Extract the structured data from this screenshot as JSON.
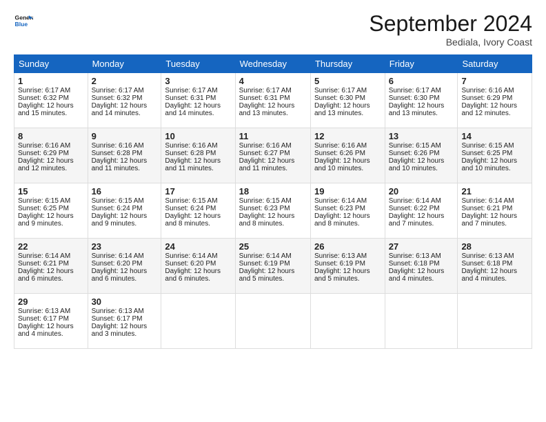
{
  "logo": {
    "line1": "General",
    "line2": "Blue"
  },
  "title": "September 2024",
  "subtitle": "Bediala, Ivory Coast",
  "days_of_week": [
    "Sunday",
    "Monday",
    "Tuesday",
    "Wednesday",
    "Thursday",
    "Friday",
    "Saturday"
  ],
  "weeks": [
    [
      {
        "day": "1",
        "rise": "6:17 AM",
        "set": "6:32 PM",
        "daylight": "12 hours and 15 minutes."
      },
      {
        "day": "2",
        "rise": "6:17 AM",
        "set": "6:32 PM",
        "daylight": "12 hours and 14 minutes."
      },
      {
        "day": "3",
        "rise": "6:17 AM",
        "set": "6:31 PM",
        "daylight": "12 hours and 14 minutes."
      },
      {
        "day": "4",
        "rise": "6:17 AM",
        "set": "6:31 PM",
        "daylight": "12 hours and 13 minutes."
      },
      {
        "day": "5",
        "rise": "6:17 AM",
        "set": "6:30 PM",
        "daylight": "12 hours and 13 minutes."
      },
      {
        "day": "6",
        "rise": "6:17 AM",
        "set": "6:30 PM",
        "daylight": "12 hours and 13 minutes."
      },
      {
        "day": "7",
        "rise": "6:16 AM",
        "set": "6:29 PM",
        "daylight": "12 hours and 12 minutes."
      }
    ],
    [
      {
        "day": "8",
        "rise": "6:16 AM",
        "set": "6:29 PM",
        "daylight": "12 hours and 12 minutes."
      },
      {
        "day": "9",
        "rise": "6:16 AM",
        "set": "6:28 PM",
        "daylight": "12 hours and 11 minutes."
      },
      {
        "day": "10",
        "rise": "6:16 AM",
        "set": "6:28 PM",
        "daylight": "12 hours and 11 minutes."
      },
      {
        "day": "11",
        "rise": "6:16 AM",
        "set": "6:27 PM",
        "daylight": "12 hours and 11 minutes."
      },
      {
        "day": "12",
        "rise": "6:16 AM",
        "set": "6:26 PM",
        "daylight": "12 hours and 10 minutes."
      },
      {
        "day": "13",
        "rise": "6:15 AM",
        "set": "6:26 PM",
        "daylight": "12 hours and 10 minutes."
      },
      {
        "day": "14",
        "rise": "6:15 AM",
        "set": "6:25 PM",
        "daylight": "12 hours and 10 minutes."
      }
    ],
    [
      {
        "day": "15",
        "rise": "6:15 AM",
        "set": "6:25 PM",
        "daylight": "12 hours and 9 minutes."
      },
      {
        "day": "16",
        "rise": "6:15 AM",
        "set": "6:24 PM",
        "daylight": "12 hours and 9 minutes."
      },
      {
        "day": "17",
        "rise": "6:15 AM",
        "set": "6:24 PM",
        "daylight": "12 hours and 8 minutes."
      },
      {
        "day": "18",
        "rise": "6:15 AM",
        "set": "6:23 PM",
        "daylight": "12 hours and 8 minutes."
      },
      {
        "day": "19",
        "rise": "6:14 AM",
        "set": "6:23 PM",
        "daylight": "12 hours and 8 minutes."
      },
      {
        "day": "20",
        "rise": "6:14 AM",
        "set": "6:22 PM",
        "daylight": "12 hours and 7 minutes."
      },
      {
        "day": "21",
        "rise": "6:14 AM",
        "set": "6:21 PM",
        "daylight": "12 hours and 7 minutes."
      }
    ],
    [
      {
        "day": "22",
        "rise": "6:14 AM",
        "set": "6:21 PM",
        "daylight": "12 hours and 6 minutes."
      },
      {
        "day": "23",
        "rise": "6:14 AM",
        "set": "6:20 PM",
        "daylight": "12 hours and 6 minutes."
      },
      {
        "day": "24",
        "rise": "6:14 AM",
        "set": "6:20 PM",
        "daylight": "12 hours and 6 minutes."
      },
      {
        "day": "25",
        "rise": "6:14 AM",
        "set": "6:19 PM",
        "daylight": "12 hours and 5 minutes."
      },
      {
        "day": "26",
        "rise": "6:13 AM",
        "set": "6:19 PM",
        "daylight": "12 hours and 5 minutes."
      },
      {
        "day": "27",
        "rise": "6:13 AM",
        "set": "6:18 PM",
        "daylight": "12 hours and 4 minutes."
      },
      {
        "day": "28",
        "rise": "6:13 AM",
        "set": "6:18 PM",
        "daylight": "12 hours and 4 minutes."
      }
    ],
    [
      {
        "day": "29",
        "rise": "6:13 AM",
        "set": "6:17 PM",
        "daylight": "12 hours and 4 minutes."
      },
      {
        "day": "30",
        "rise": "6:13 AM",
        "set": "6:17 PM",
        "daylight": "12 hours and 3 minutes."
      },
      null,
      null,
      null,
      null,
      null
    ]
  ],
  "labels": {
    "sunrise": "Sunrise:",
    "sunset": "Sunset:",
    "daylight": "Daylight:"
  }
}
